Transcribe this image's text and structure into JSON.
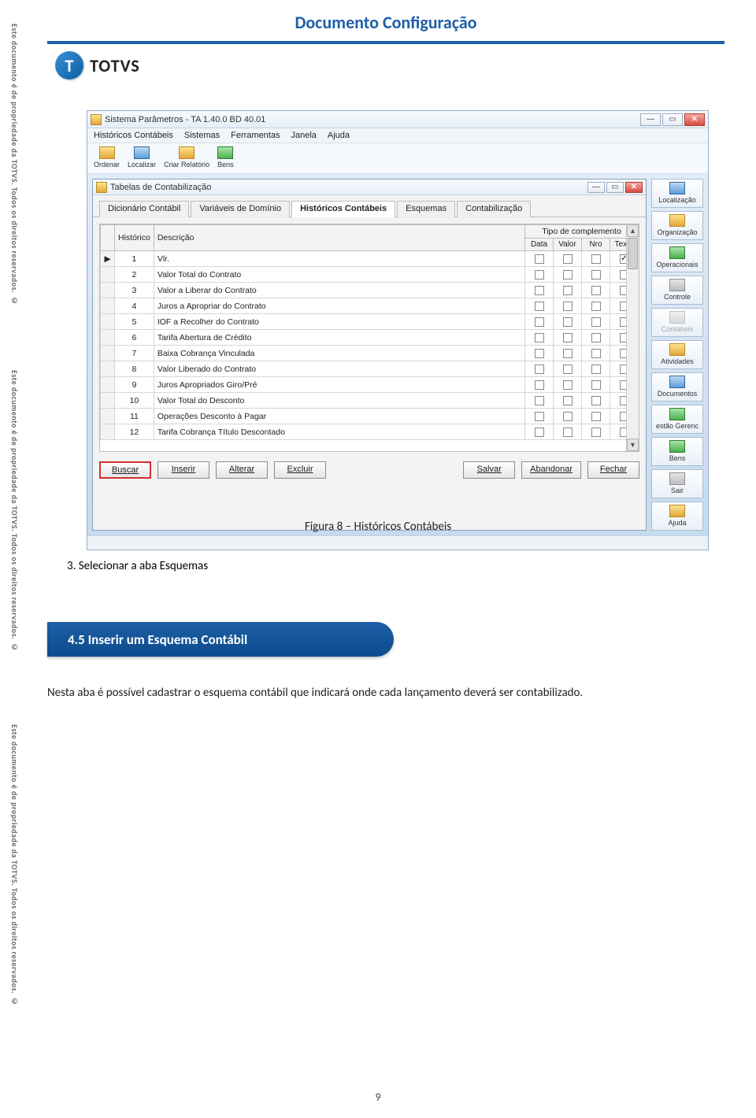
{
  "side_copyright": "Este documento é de propriedade da TOTVS. Todos os direitos reservados. ©",
  "doc": {
    "header": "Documento Configuração",
    "logo_text": "TOTVS",
    "caption": "Figura 8 – Históricos Contábeis",
    "step": "3. Selecionar a aba Esquemas",
    "section": "4.5    Inserir um Esquema Contábil",
    "paragraph": "Nesta aba é possível cadastrar o esquema contábil que indicará onde cada lançamento deverá ser contabilizado.",
    "page_number": "9"
  },
  "outer": {
    "title": "Sistema Parâmetros - TA 1.40.0 BD 40.01",
    "menu": [
      "Históricos Contábeis",
      "Sistemas",
      "Ferramentas",
      "Janela",
      "Ajuda"
    ],
    "toolbar": [
      {
        "label": "Ordenar"
      },
      {
        "label": "Localizar"
      },
      {
        "label": "Criar Relatório"
      },
      {
        "label": "Bens"
      }
    ]
  },
  "inner": {
    "title": "Tabelas de Contabilização",
    "tabs": [
      "Dicionário Contábil",
      "Variáveis de Domínio",
      "Históricos Contábeis",
      "Esquemas",
      "Contabilização"
    ],
    "active_tab_index": 2,
    "columns": {
      "historico": "Histórico",
      "descricao": "Descrição",
      "tipo_compl": "Tipo de complemento",
      "sub": [
        "Data",
        "Valor",
        "Nro",
        "Texto"
      ]
    },
    "rows": [
      {
        "n": "1",
        "desc": "Vlr.",
        "chk": [
          false,
          false,
          false,
          true
        ]
      },
      {
        "n": "2",
        "desc": "Valor Total do Contrato",
        "chk": [
          false,
          false,
          false,
          false
        ]
      },
      {
        "n": "3",
        "desc": "Valor a Liberar do Contrato",
        "chk": [
          false,
          false,
          false,
          false
        ]
      },
      {
        "n": "4",
        "desc": "Juros a Apropriar do Contrato",
        "chk": [
          false,
          false,
          false,
          false
        ]
      },
      {
        "n": "5",
        "desc": "IOF a Recolher do Contrato",
        "chk": [
          false,
          false,
          false,
          false
        ]
      },
      {
        "n": "6",
        "desc": "Tarifa Abertura de Crédito",
        "chk": [
          false,
          false,
          false,
          false
        ]
      },
      {
        "n": "7",
        "desc": "Baixa Cobrança Vinculada",
        "chk": [
          false,
          false,
          false,
          false
        ]
      },
      {
        "n": "8",
        "desc": "Valor Liberado do Contrato",
        "chk": [
          false,
          false,
          false,
          false
        ]
      },
      {
        "n": "9",
        "desc": "Juros Apropriados Giro/Pré",
        "chk": [
          false,
          false,
          false,
          false
        ]
      },
      {
        "n": "10",
        "desc": "Valor Total do Desconto",
        "chk": [
          false,
          false,
          false,
          false
        ]
      },
      {
        "n": "11",
        "desc": "Operações Desconto à Pagar",
        "chk": [
          false,
          false,
          false,
          false
        ]
      },
      {
        "n": "12",
        "desc": "Tarifa Cobrança Título Descontado",
        "chk": [
          false,
          false,
          false,
          false
        ]
      }
    ],
    "buttons": {
      "buscar": "Buscar",
      "inserir": "Inserir",
      "alterar": "Alterar",
      "excluir": "Excluir",
      "salvar": "Salvar",
      "abandonar": "Abandonar",
      "fechar": "Fechar"
    }
  },
  "sidebar": [
    {
      "label": "Localização"
    },
    {
      "label": "Organização"
    },
    {
      "label": "Operacionais"
    },
    {
      "label": "Controle"
    },
    {
      "label": "Contábeis",
      "faded": true
    },
    {
      "label": "Atividades"
    },
    {
      "label": "Documentos"
    },
    {
      "label": "estão Gerenc"
    },
    {
      "label": "Bens"
    },
    {
      "label": "Sair"
    },
    {
      "label": "Ajuda"
    }
  ]
}
